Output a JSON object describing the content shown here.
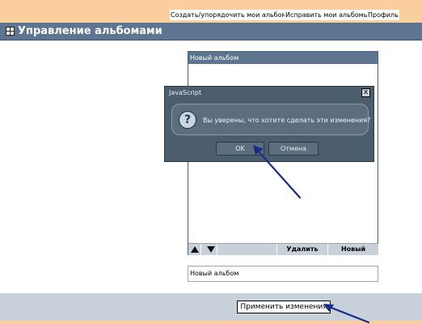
{
  "topnav": {
    "links": [
      {
        "label": "Создать/упорядочить мои альбомы"
      },
      {
        "label": "Исправить мои альбомы"
      },
      {
        "label": "Профиль"
      }
    ]
  },
  "header": {
    "title": "Управление альбомами",
    "icon": "expand-plus-icon"
  },
  "album_list": {
    "header_label": "Новый альбом",
    "delete_label": "Удалить",
    "new_label": "Новый"
  },
  "album_name_field": {
    "value": "Новый альбом"
  },
  "apply_button": {
    "label": "Применить изменения"
  },
  "dialog": {
    "title": "JavaScript",
    "close_glyph": "x",
    "message": "Вы уверены, что хотите сделать эти изменения?",
    "ok_label": "OK",
    "cancel_label": "Отмена",
    "icon": "question-icon"
  },
  "colors": {
    "page_bg": "#fbcf9d",
    "header_bg": "#5d7590",
    "dialog_bg": "#4c5d6d",
    "arrow": "#1a2b8c"
  }
}
